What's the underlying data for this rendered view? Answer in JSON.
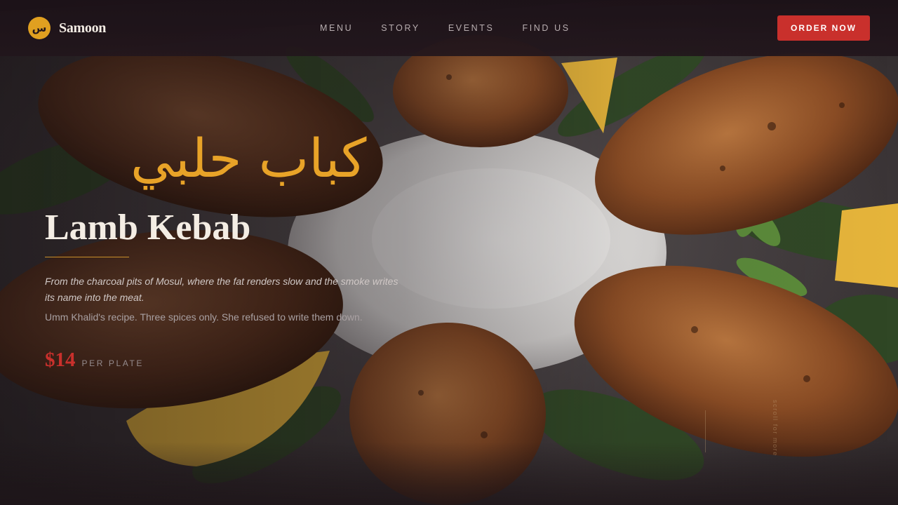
{
  "brand": {
    "logo_glyph": "س",
    "name": "Samoon",
    "accent_color": "#e0a020"
  },
  "nav": {
    "links": [
      "MENU",
      "STORY",
      "EVENTS",
      "FIND US"
    ],
    "cta_label": "ORDER NOW",
    "cta_color": "#c9302c"
  },
  "hero": {
    "arabic_title": "كباب حلبي",
    "title": "Lamb Kebab",
    "tagline": "From the charcoal pits of Mosul, where the fat renders slow and the smoke writes its name into the meat.",
    "recipe_note": "Umm Khalid's recipe. Three spices only. She refused to write them down.",
    "price": "$14",
    "price_unit": "PER PLATE",
    "side_caption": "scroll for more",
    "background_image": "grilled-kebab-photo"
  }
}
